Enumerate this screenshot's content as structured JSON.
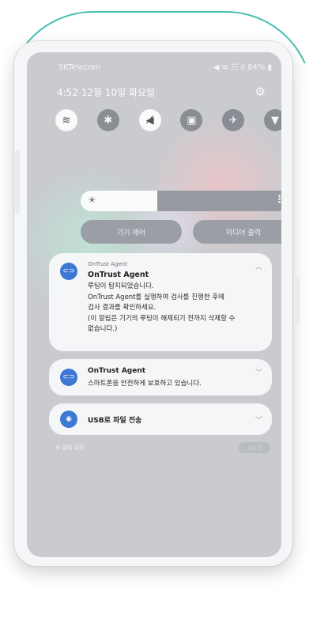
{
  "status_bar": {
    "carrier": "SKTelecom",
    "right": "◀ ≋ ☷ ıl 84% ▮"
  },
  "panel": {
    "datetime": "4:52 12월 10일 화요일"
  },
  "quick_toggles": [
    {
      "icon": "wifi-icon",
      "glyph": "≋",
      "on": true
    },
    {
      "icon": "bluetooth-icon",
      "glyph": "✱",
      "on": false
    },
    {
      "icon": "mute-icon",
      "glyph": "◀̸",
      "on": true
    },
    {
      "icon": "screen-rotation-icon",
      "glyph": "▣",
      "on": false
    },
    {
      "icon": "airplane-icon",
      "glyph": "✈",
      "on": false
    },
    {
      "icon": "flashlight-icon",
      "glyph": "▼",
      "on": false
    }
  ],
  "brightness": {
    "level": 0.36
  },
  "buttons": {
    "device_control": "기기 제어",
    "media_output": "미디어 출력"
  },
  "notifications": {
    "first": {
      "app_name": "OnTrust Agent",
      "title": "OnTrust Agent",
      "lines": [
        "루팅이 탐지되었습니다.",
        "OnTrust Agent를 실행하여 검사를 진행한 후에",
        "검사 결과를 확인하세요.",
        "(이 알림은 기기의 루팅이 해제되기 전까지 삭제할 수",
        "없습니다.)"
      ]
    },
    "second": {
      "title": "OnTrust Agent",
      "subtitle": "스마트폰을 안전하게 보호하고 있습니다."
    },
    "third": {
      "title": "USB로 파일 전송"
    }
  },
  "footer": {
    "notification_settings": "⚙ 알림 설정",
    "clear": "지우기"
  }
}
